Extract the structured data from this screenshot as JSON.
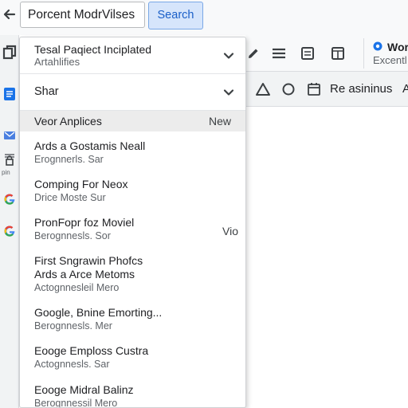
{
  "search": {
    "value": "Porcent ModrVilses",
    "button_label": "Search"
  },
  "toolbar": {
    "icons": [
      "pencil-icon",
      "menu-icon",
      "document-icon",
      "window-icon"
    ],
    "account_title": "Wor",
    "account_subtitle": "Excentl"
  },
  "subbar": {
    "label": "Re asininus",
    "trailing": "A"
  },
  "panel": {
    "header": {
      "title": "Tesal Paqiect Inciplated",
      "subtitle": "Artahlifies"
    },
    "section": {
      "label": "Shar"
    },
    "selected": {
      "label": "Veor Anplices",
      "badge": "New"
    },
    "items": [
      {
        "title": "Ards a Gostamis Neall",
        "subtitle": "Erognnerls. Sar"
      },
      {
        "title": "Comping For Neox",
        "subtitle": "Drice Moste Sur"
      },
      {
        "title": "PronFopr foz Moviel",
        "subtitle": "Berognnesls. Sor"
      },
      {
        "title": "First Sngrawin Phofcs",
        "title2": "Ards a Arce Metoms",
        "subtitle": "Actognnesleil Mero"
      },
      {
        "title": "Google, Bnine Emorting...",
        "subtitle": "Berognnesls. Mer"
      },
      {
        "title": "Eooge Emploss Custra",
        "subtitle": "Actognnesls. Sar"
      },
      {
        "title": "Eooge Midral Balinz",
        "subtitle": "Berognnessil Mero"
      }
    ],
    "aside_label": "Vio"
  },
  "rail": {
    "pin_label": "pin"
  },
  "colors": {
    "accent": "#1a73e8",
    "search_button_bg": "#d6e5fb",
    "selected_row": "#ececec",
    "google_red": "#ea4335",
    "google_yellow": "#fbbc05",
    "google_green": "#34a853",
    "google_blue": "#4285f4"
  }
}
